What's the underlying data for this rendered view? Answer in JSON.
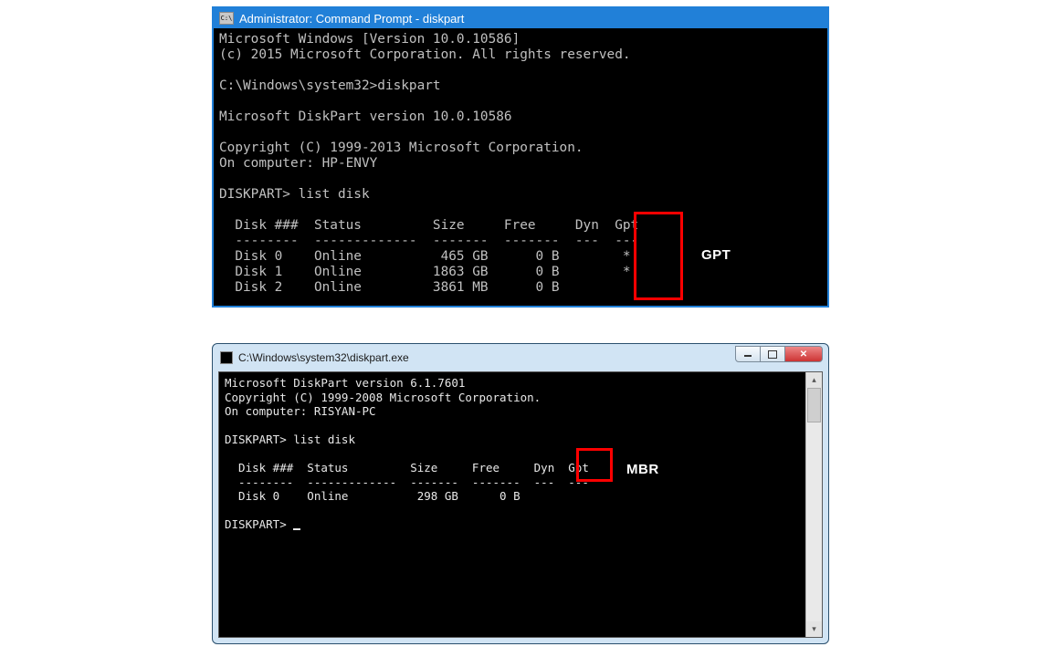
{
  "win1": {
    "title": "Administrator: Command Prompt - diskpart",
    "body": "Microsoft Windows [Version 10.0.10586]\n(c) 2015 Microsoft Corporation. All rights reserved.\n\nC:\\Windows\\system32>diskpart\n\nMicrosoft DiskPart version 10.0.10586\n\nCopyright (C) 1999-2013 Microsoft Corporation.\nOn computer: HP-ENVY\n\nDISKPART> list disk\n\n  Disk ###  Status         Size     Free     Dyn  Gpt\n  --------  -------------  -------  -------  ---  ---\n  Disk 0    Online          465 GB      0 B        *\n  Disk 1    Online         1863 GB      0 B        *\n  Disk 2    Online         3861 MB      0 B"
  },
  "win2": {
    "title": "C:\\Windows\\system32\\diskpart.exe",
    "body": "Microsoft DiskPart version 6.1.7601\nCopyright (C) 1999-2008 Microsoft Corporation.\nOn computer: RISYAN-PC\n\nDISKPART> list disk\n\n  Disk ###  Status         Size     Free     Dyn  Gpt\n  --------  -------------  -------  -------  ---  ---\n  Disk 0    Online          298 GB      0 B\n\nDISKPART> "
  },
  "labels": {
    "gpt": "GPT",
    "mbr": "MBR"
  }
}
